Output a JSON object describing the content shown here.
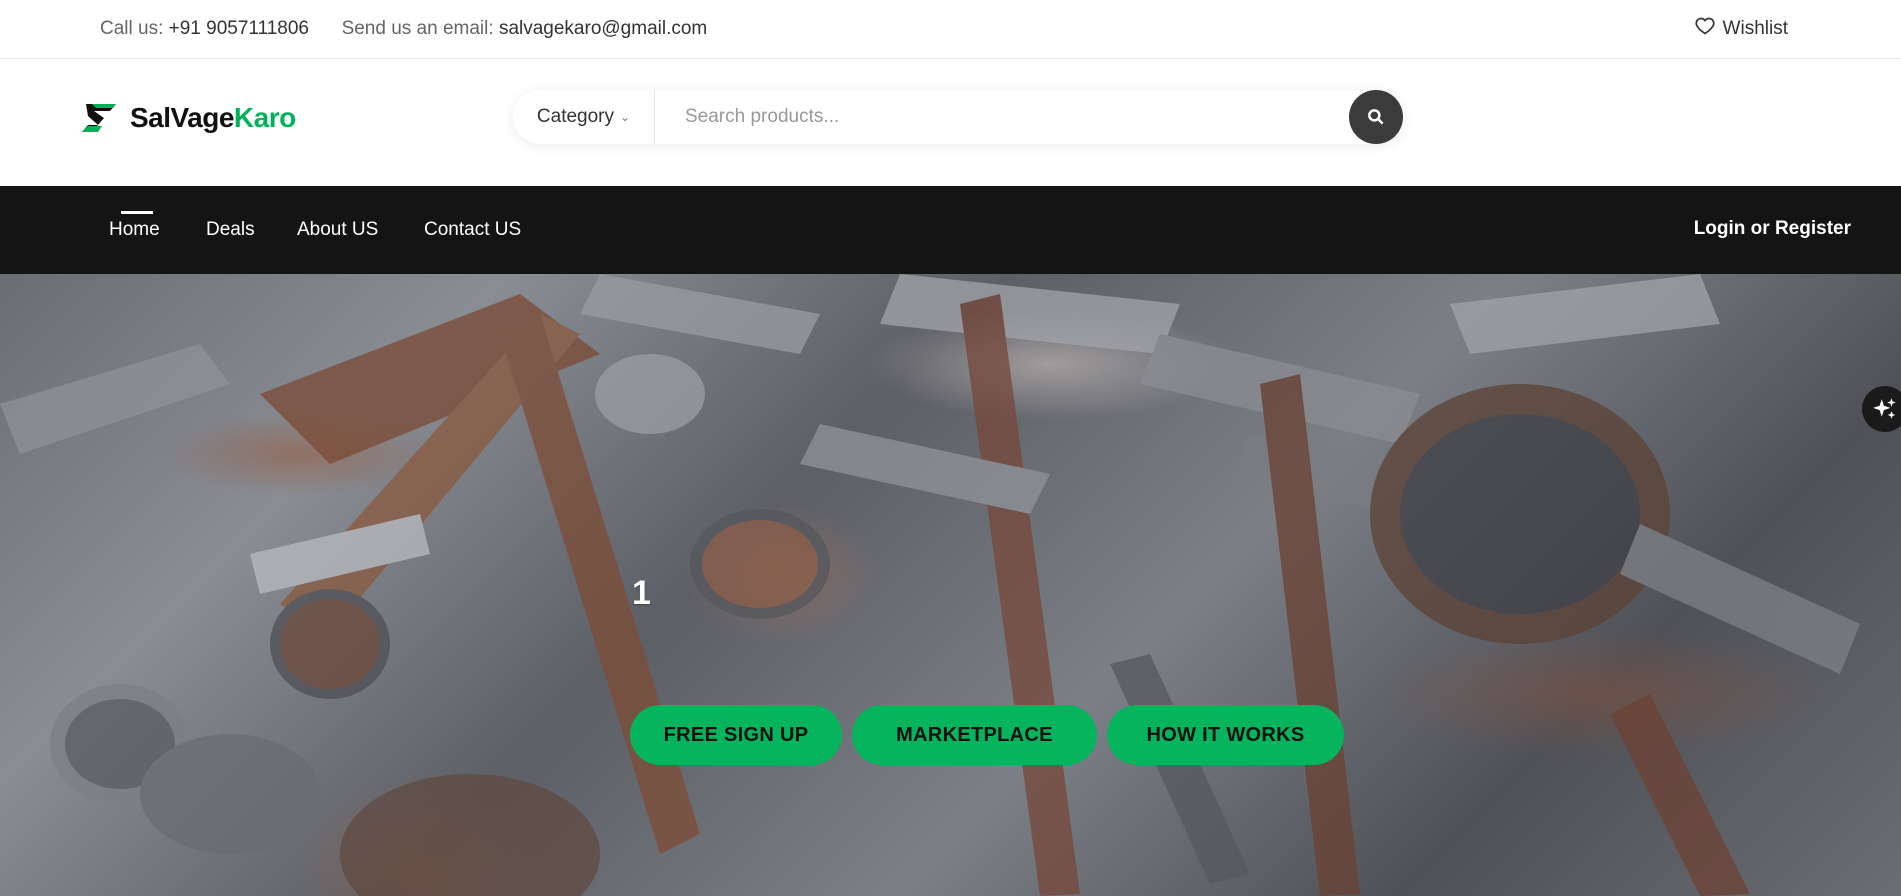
{
  "topbar": {
    "call_label": "Call us:",
    "phone": "+91 9057111806",
    "email_label": "Send us an email:",
    "email": "salvagekaro@gmail.com",
    "wishlist_label": "Wishlist"
  },
  "logo": {
    "word_part1": "SalVage",
    "word_part2": "Karo"
  },
  "search": {
    "category_label": "Category",
    "placeholder": "Search products..."
  },
  "nav": {
    "items": [
      {
        "label": "Home",
        "active": true
      },
      {
        "label": "Deals"
      },
      {
        "label": "About US"
      },
      {
        "label": "Contact US"
      }
    ],
    "login_label": "Login or Register"
  },
  "hero": {
    "slide_indicator": "1",
    "buttons": [
      {
        "label": "FREE SIGN UP"
      },
      {
        "label": "MARKETPLACE"
      },
      {
        "label": "HOW IT WORKS"
      }
    ]
  },
  "colors": {
    "brand_green": "#05b45c",
    "nav_background": "#141414",
    "search_button": "#3b3b3b"
  },
  "icons": {
    "wishlist": "heart-icon",
    "category": "chevron-down-icon",
    "search": "search-icon",
    "assistant": "sparkle-icon"
  }
}
